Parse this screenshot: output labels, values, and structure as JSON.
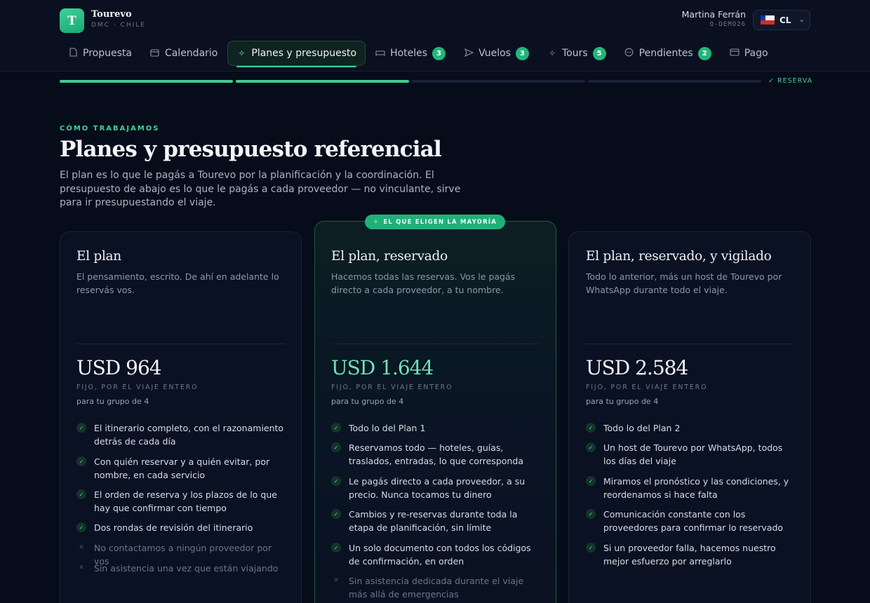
{
  "brand": {
    "logo_letter": "T",
    "name": "Tourevo",
    "subtitle": "DMC · CHILE"
  },
  "user": {
    "name": "Martina Ferrán",
    "code": "Q-DEMO26",
    "country_code": "CL"
  },
  "tabs": [
    {
      "label": "Propuesta",
      "icon": "document-icon",
      "badge": null
    },
    {
      "label": "Calendario",
      "icon": "calendar-icon",
      "badge": null
    },
    {
      "label": "Planes y presupuesto",
      "icon": "sparkle-icon",
      "badge": null,
      "active": true
    },
    {
      "label": "Hoteles",
      "icon": "bed-icon",
      "badge": "3"
    },
    {
      "label": "Vuelos",
      "icon": "plane-icon",
      "badge": "3"
    },
    {
      "label": "Tours",
      "icon": "sparkle-icon",
      "badge": "5"
    },
    {
      "label": "Pendientes",
      "icon": "chat-icon",
      "badge": "2"
    },
    {
      "label": "Pago",
      "icon": "card-icon",
      "badge": null
    }
  ],
  "progress": {
    "completed_steps": 2,
    "total_steps": 4,
    "end_label": "✓ RESERVA"
  },
  "header": {
    "kicker": "CÓMO TRABAJAMOS",
    "title": "Planes y presupuesto referencial",
    "intro": "El plan es lo que le pagás a Tourevo por la planificación y la coordinación. El presupuesto de abajo es lo que le pagás a cada proveedor — no vinculante, sirve para ir presupuestando el viaje."
  },
  "featured_badge": "EL QUE ELIGEN LA MAYORÍA",
  "plans": [
    {
      "title": "El plan",
      "description": "El pensamiento, escrito. De ahí en adelante lo reservás vos.",
      "price": "USD 964",
      "price_note": "FIJO, POR EL VIAJE ENTERO",
      "group": "para tu grupo de 4",
      "features": [
        {
          "text": "El itinerario completo, con el razonamiento detrás de cada día",
          "included": true
        },
        {
          "text": "Con quién reservar y a quién evitar, por nombre, en cada servicio",
          "included": true
        },
        {
          "text": "El orden de reserva y los plazos de lo que hay que confirmar con tiempo",
          "included": true
        },
        {
          "text": "Dos rondas de revisión del itinerario",
          "included": true
        },
        {
          "text": "No contactamos a ningún proveedor por vos",
          "included": false
        },
        {
          "text": "Sin asistencia una vez que están viajando",
          "included": false
        }
      ]
    },
    {
      "title": "El plan, reservado",
      "description": "Hacemos todas las reservas. Vos le pagás directo a cada proveedor, a tu nombre.",
      "price": "USD 1.644",
      "price_note": "FIJO, POR EL VIAJE ENTERO",
      "group": "para tu grupo de 4",
      "features": [
        {
          "text": "Todo lo del Plan 1",
          "included": true
        },
        {
          "text": "Reservamos todo — hoteles, guías, traslados, entradas, lo que corresponda",
          "included": true
        },
        {
          "text": "Le pagás directo a cada proveedor, a su precio. Nunca tocamos tu dinero",
          "included": true
        },
        {
          "text": "Cambios y re-reservas durante toda la etapa de planificación, sin límite",
          "included": true
        },
        {
          "text": "Un solo documento con todos los códigos de confirmación, en orden",
          "included": true
        },
        {
          "text": "Sin asistencia dedicada durante el viaje más allá de emergencias",
          "included": false
        }
      ]
    },
    {
      "title": "El plan, reservado, y vigilado",
      "description": "Todo lo anterior, más un host de Tourevo por WhatsApp durante todo el viaje.",
      "price": "USD 2.584",
      "price_note": "FIJO, POR EL VIAJE ENTERO",
      "group": "para tu grupo de 4",
      "features": [
        {
          "text": "Todo lo del Plan 2",
          "included": true
        },
        {
          "text": "Un host de Tourevo por WhatsApp, todos los días del viaje",
          "included": true
        },
        {
          "text": "Miramos el pronóstico y las condiciones, y reordenamos si hace falta",
          "included": true
        },
        {
          "text": "Comunicación constante con los proveedores para confirmar lo reservado",
          "included": true
        },
        {
          "text": "Si un proveedor falla, hacemos nuestro mejor esfuerzo por arreglarlo",
          "included": true
        }
      ]
    }
  ],
  "colors": {
    "accent": "#3fd19a",
    "background": "#070c1a",
    "badge": "#22b67b"
  }
}
